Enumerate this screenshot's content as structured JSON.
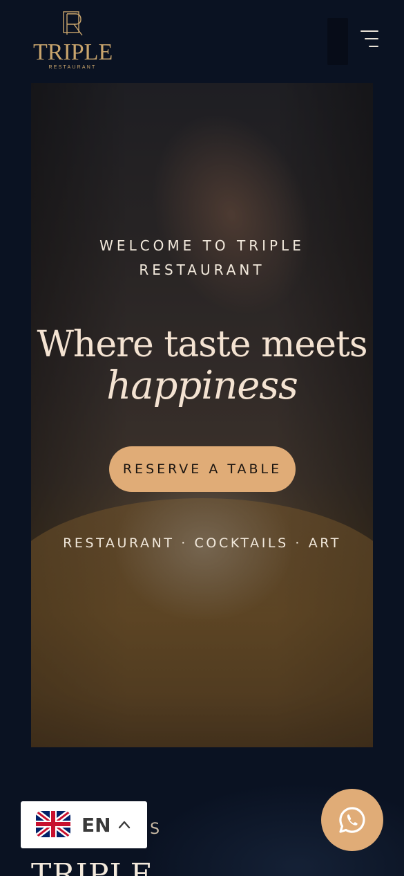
{
  "header": {
    "logo_word": "TRIPLE",
    "logo_sub": "RESTAURANT",
    "menu_icon": "hamburger-menu-icon"
  },
  "hero": {
    "welcome": "WELCOME TO TRIPLE RESTAURANT",
    "title": "Where taste meets",
    "title_italic": "happiness",
    "reserve_button": "RESERVE A TABLE",
    "tagline": "RESTAURANT · COCKTAILS · ART"
  },
  "about": {
    "label": "US",
    "title": "TRIPLE"
  },
  "language": {
    "code": "EN",
    "flag_icon": "uk-flag-icon",
    "chevron_icon": "chevron-up-icon"
  },
  "whatsapp": {
    "icon": "whatsapp-icon"
  },
  "colors": {
    "background": "#0a1222",
    "accent": "#e0ac77",
    "logo_gold": "#c9a56d",
    "hero_text": "#f4e3d2"
  }
}
